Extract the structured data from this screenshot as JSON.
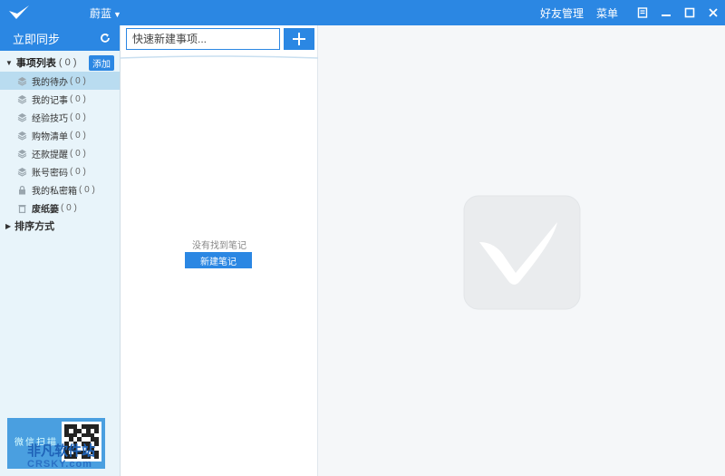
{
  "titlebar": {
    "skin_label": "蔚蓝",
    "links": {
      "friends": "好友管理",
      "menu": "菜单"
    },
    "accent_color": "#2b87e3"
  },
  "sidebar": {
    "sync_label": "立即同步",
    "list_header": {
      "label": "事项列表",
      "count": "( 0 )",
      "add_label": "添加"
    },
    "items": [
      {
        "label": "我的待办",
        "count": "( 0 )",
        "icon": "stack-icon"
      },
      {
        "label": "我的记事",
        "count": "( 0 )",
        "icon": "stack-icon"
      },
      {
        "label": "经验技巧",
        "count": "( 0 )",
        "icon": "stack-icon"
      },
      {
        "label": "购物清单",
        "count": "( 0 )",
        "icon": "stack-icon"
      },
      {
        "label": "还款提醒",
        "count": "( 0 )",
        "icon": "stack-icon"
      },
      {
        "label": "账号密码",
        "count": "( 0 )",
        "icon": "stack-icon"
      },
      {
        "label": "我的私密箱",
        "count": "( 0 )",
        "icon": "lock-icon"
      },
      {
        "label": "废纸篓",
        "count": "( 0 )",
        "icon": "trash-icon"
      }
    ],
    "sort_label": "排序方式",
    "banner_text": "微信扫描",
    "watermark": {
      "main": "非凡软件站",
      "sub": "CRSKY.com"
    }
  },
  "middle": {
    "search_placeholder": "快速新建事项...",
    "empty_text": "没有找到笔记",
    "new_note_label": "新建笔记"
  }
}
